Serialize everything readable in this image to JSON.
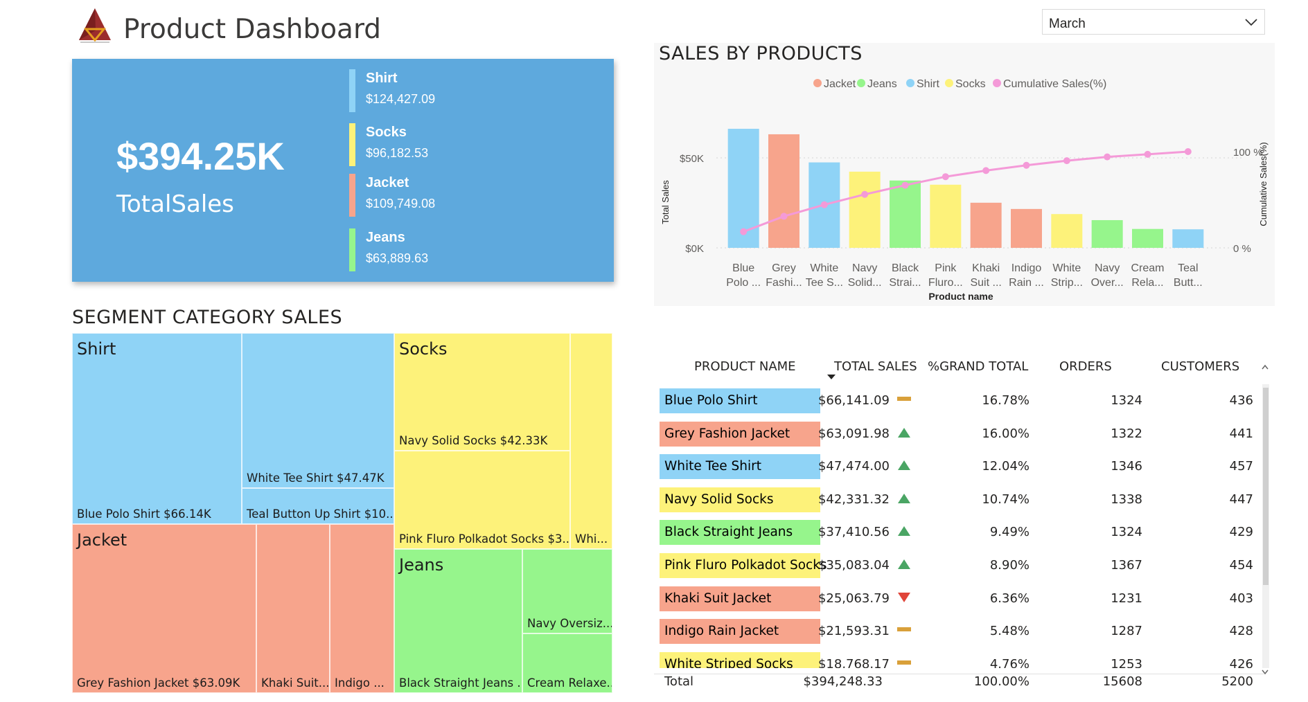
{
  "header": {
    "title": "Product Dashboard"
  },
  "filter": {
    "selected": "March"
  },
  "kpi": {
    "total_value": "$394.25K",
    "total_label": "TotalSales",
    "items": [
      {
        "name": "Shirt",
        "value": "$124,427.09",
        "color": "#8fd3f6"
      },
      {
        "name": "Socks",
        "value": "$96,182.53",
        "color": "#fdf27a"
      },
      {
        "name": "Jacket",
        "value": "$109,749.08",
        "color": "#f7a48c"
      },
      {
        "name": "Jeans",
        "value": "$63,889.63",
        "color": "#96f58c"
      }
    ]
  },
  "chart_title": "SALES BY PRODUCTS",
  "chart_data": {
    "type": "bar",
    "title": "SALES BY PRODUCTS",
    "xlabel": "Product name",
    "ylabel": "Total Sales",
    "y2label": "Cumulative Sales(%)",
    "ylim": [
      0,
      50000
    ],
    "y_ticks": [
      "$0K",
      "$50K"
    ],
    "y2_ticks": [
      "0 %",
      "100 %"
    ],
    "legend_position": "top-center",
    "legend": [
      {
        "name": "Jacket",
        "color": "#f7a48c"
      },
      {
        "name": "Jeans",
        "color": "#96f58c"
      },
      {
        "name": "Shirt",
        "color": "#8fd3f6"
      },
      {
        "name": "Socks",
        "color": "#fdf27a"
      },
      {
        "name": "Cumulative Sales(%)",
        "color": "#f49ad8"
      }
    ],
    "categories": [
      [
        "Blue",
        "Polo ..."
      ],
      [
        "Grey",
        "Fashi..."
      ],
      [
        "White",
        "Tee S..."
      ],
      [
        "Navy",
        "Solid..."
      ],
      [
        "Black",
        "Strai..."
      ],
      [
        "Pink",
        "Fluro..."
      ],
      [
        "Khaki",
        "Suit ..."
      ],
      [
        "Indigo",
        "Rain ..."
      ],
      [
        "White",
        "Strip..."
      ],
      [
        "Navy",
        "Over..."
      ],
      [
        "Cream",
        "Rela..."
      ],
      [
        "Teal",
        "Butt..."
      ]
    ],
    "values": [
      66141.09,
      63091.98,
      47474.0,
      42331.32,
      37410.56,
      35083.04,
      25063.79,
      21593.31,
      18768.17,
      15400,
      10500,
      10300
    ],
    "bar_colors": [
      "#8fd3f6",
      "#f7a48c",
      "#8fd3f6",
      "#fdf27a",
      "#96f58c",
      "#fdf27a",
      "#f7a48c",
      "#f7a48c",
      "#fdf27a",
      "#96f58c",
      "#96f58c",
      "#8fd3f6"
    ],
    "cumulative_pct": [
      16.78,
      32.78,
      44.82,
      55.56,
      65.05,
      73.95,
      80.31,
      85.79,
      90.55,
      94.5,
      97.2,
      100
    ]
  },
  "treemap": {
    "title": "SEGMENT CATEGORY SALES",
    "groups": [
      {
        "name": "Shirt",
        "color": "#8fd3f6"
      },
      {
        "name": "Socks",
        "color": "#fdf27a"
      },
      {
        "name": "Jacket",
        "color": "#f7a48c"
      },
      {
        "name": "Jeans",
        "color": "#96f58c"
      }
    ],
    "labels": {
      "blue_polo": "Blue Polo Shirt $66.14K",
      "white_tee": "White Tee Shirt $47.47K",
      "teal_button": "Teal Button Up Shirt $10....",
      "navy_socks": "Navy Solid Socks $42.33K",
      "pink_socks": "Pink Fluro Polkadot Socks $3...",
      "white_socks": "Whi...",
      "grey_jacket": "Grey Fashion Jacket $63.09K",
      "khaki_jacket": "Khaki Suit...",
      "indigo_jacket": "Indigo ...",
      "black_jeans": "Black Straight Jeans ...",
      "navy_jeans": "Navy Oversiz...",
      "cream_jeans": "Cream Relaxe..."
    }
  },
  "table": {
    "headers": [
      "PRODUCT NAME",
      "TOTAL SALES",
      "%GRAND TOTAL",
      "ORDERS",
      "CUSTOMERS"
    ],
    "rows": [
      {
        "name": "Blue Polo Shirt",
        "sales": "$66,141.09",
        "pct": "16.78%",
        "orders": "1324",
        "customers": "436",
        "color": "#8fd3f6",
        "trend": "flat"
      },
      {
        "name": "Grey Fashion Jacket",
        "sales": "$63,091.98",
        "pct": "16.00%",
        "orders": "1322",
        "customers": "441",
        "color": "#f7a48c",
        "trend": "up"
      },
      {
        "name": "White Tee Shirt",
        "sales": "$47,474.00",
        "pct": "12.04%",
        "orders": "1346",
        "customers": "457",
        "color": "#8fd3f6",
        "trend": "up"
      },
      {
        "name": "Navy Solid Socks",
        "sales": "$42,331.32",
        "pct": "10.74%",
        "orders": "1338",
        "customers": "447",
        "color": "#fdf27a",
        "trend": "up"
      },
      {
        "name": "Black Straight Jeans",
        "sales": "$37,410.56",
        "pct": "9.49%",
        "orders": "1324",
        "customers": "429",
        "color": "#96f58c",
        "trend": "up"
      },
      {
        "name": "Pink Fluro Polkadot Socks",
        "sales": "$35,083.04",
        "pct": "8.90%",
        "orders": "1367",
        "customers": "454",
        "color": "#fdf27a",
        "trend": "up"
      },
      {
        "name": "Khaki Suit Jacket",
        "sales": "$25,063.79",
        "pct": "6.36%",
        "orders": "1231",
        "customers": "403",
        "color": "#f7a48c",
        "trend": "down"
      },
      {
        "name": "Indigo Rain Jacket",
        "sales": "$21,593.31",
        "pct": "5.48%",
        "orders": "1287",
        "customers": "428",
        "color": "#f7a48c",
        "trend": "flat"
      },
      {
        "name": "White Striped Socks",
        "sales": "$18,768.17",
        "pct": "4.76%",
        "orders": "1253",
        "customers": "426",
        "color": "#fdf27a",
        "trend": "flat"
      }
    ],
    "total": {
      "label": "Total",
      "sales": "$394,248.33",
      "pct": "100.00%",
      "orders": "15608",
      "customers": "5200"
    }
  }
}
